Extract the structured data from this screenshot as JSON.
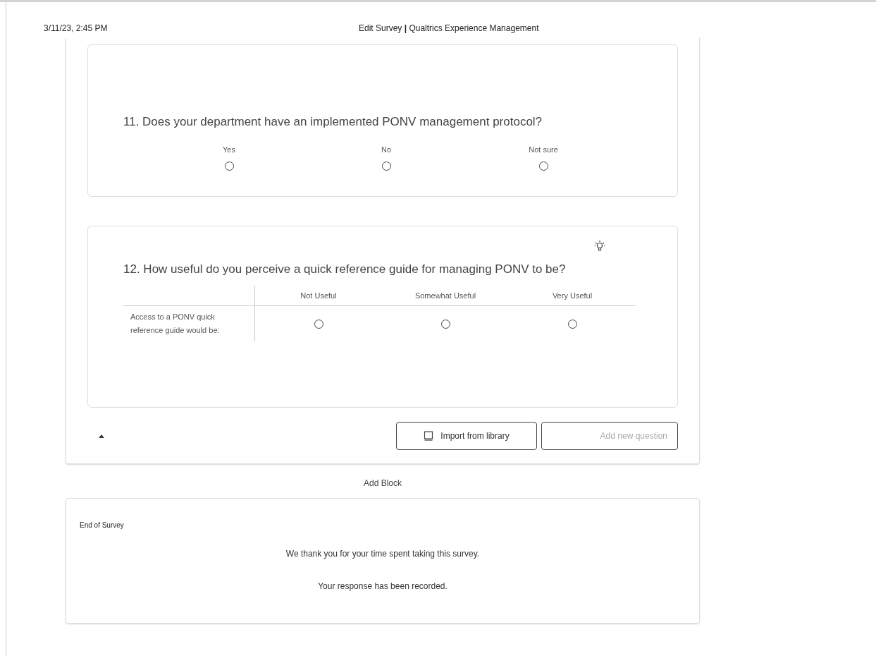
{
  "header": {
    "date": "3/11/23, 2:45 PM",
    "title": "Edit Survey **|** Qualtrics Experience Management"
  },
  "question_11": {
    "text": "11. Does your department have an implemented PONV management protocol?",
    "choices": [
      {
        "label": "Yes",
        "selected": false
      },
      {
        "label": "No",
        "selected": false
      },
      {
        "label": "Not sure",
        "selected": false
      }
    ]
  },
  "question_12": {
    "text": "12. How useful do you perceive a quick reference guide for managing PONV to be?",
    "columns": [
      "Not Useful",
      "Somewhat Useful",
      "Very Useful"
    ],
    "rows": [
      {
        "statement": "Access to a PONV quick reference guide would be:",
        "choices": [
          {
            "selected": false
          },
          {
            "selected": false
          },
          {
            "selected": false
          }
        ]
      }
    ]
  },
  "block_actions": {
    "import_button": "Import from library",
    "add_button": "Add new question",
    "add_disabled": true
  },
  "add_block": "Add Block",
  "end_of_survey": {
    "title": "End of Survey",
    "messages": [
      "We thank you for your time spent taking this survey.",
      "Your response has been recorded."
    ]
  }
}
